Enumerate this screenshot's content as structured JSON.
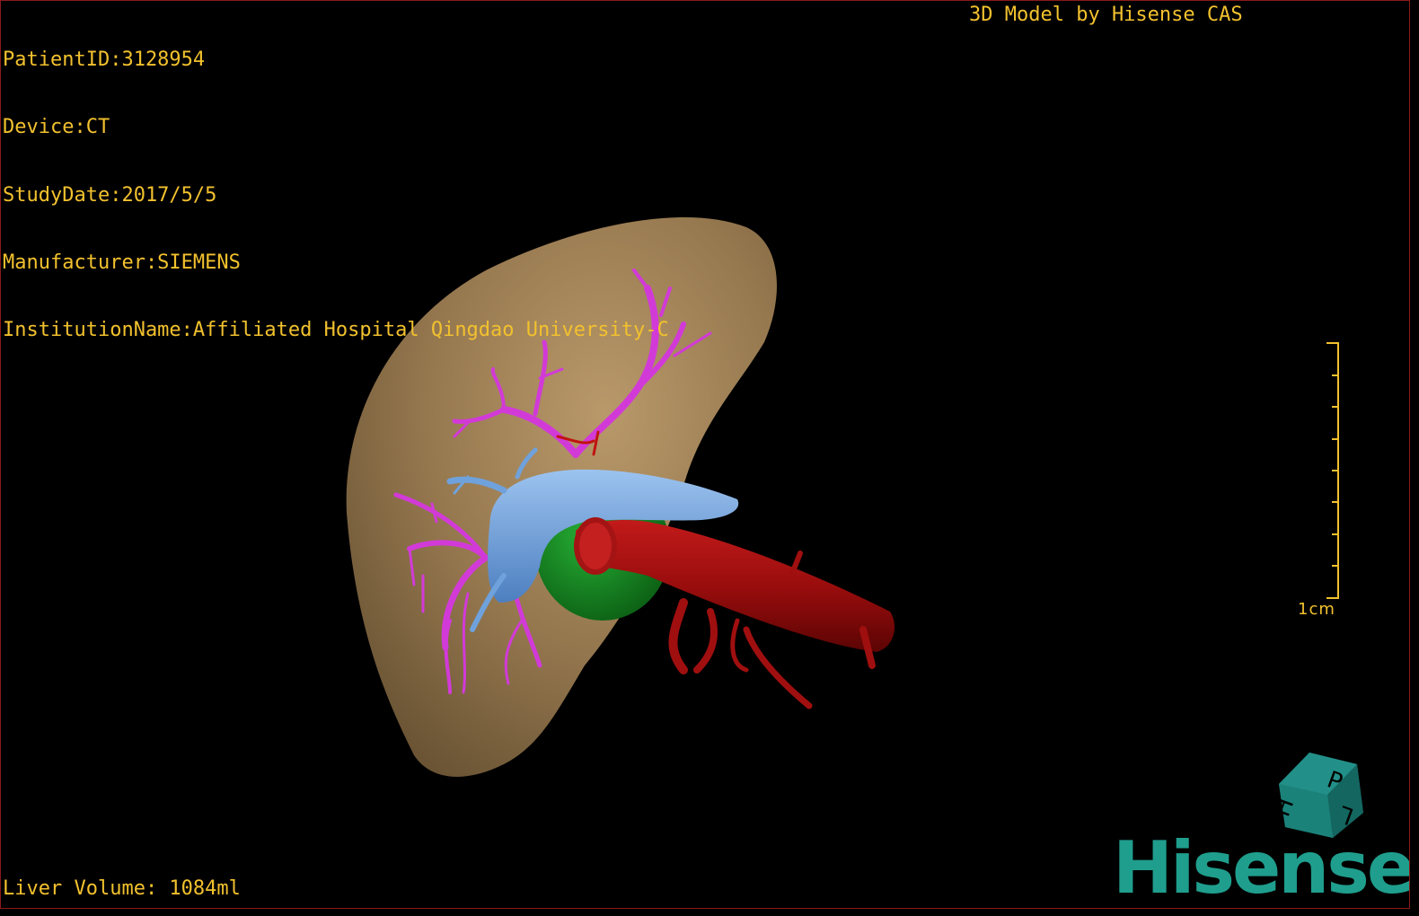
{
  "overlay": {
    "patient_id": "PatientID:3128954",
    "device": "Device:CT",
    "study_date": "StudyDate:2017/5/5",
    "manufacturer": "Manufacturer:SIEMENS",
    "institution": "InstitutionName:Affiliated Hospital Qingdao University-C",
    "credit": "3D Model by Hisense CAS",
    "liver_volume": "Liver Volume: 1084ml"
  },
  "scale": {
    "label": "1cm"
  },
  "orientation_cube": {
    "faces": [
      "P",
      "H",
      "L"
    ]
  },
  "brand": {
    "name": "Hisense"
  },
  "model": {
    "structures": [
      "liver",
      "portal-vein",
      "hepatic-vein",
      "inferior-vena-cava",
      "gallbladder",
      "hepatic-artery"
    ]
  },
  "colors": {
    "text": "#f2c12e",
    "liver": "#9c8158",
    "portal_vein": "#d23ad8",
    "hepatic_vein": "#6fa2dc",
    "ivc": "#a30f10",
    "gallbladder": "#148c1e",
    "brand": "#1f9e8d",
    "frame": "#8a1a1a"
  }
}
